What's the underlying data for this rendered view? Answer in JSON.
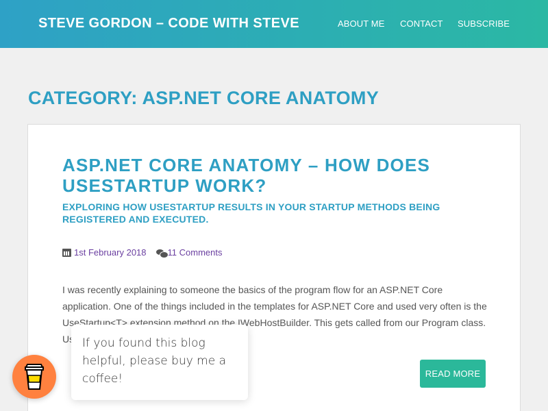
{
  "header": {
    "site_title": "STEVE GORDON – CODE WITH STEVE",
    "nav": [
      "ABOUT ME",
      "CONTACT",
      "SUBSCRIBE"
    ]
  },
  "category_title": "CATEGORY: ASP.NET CORE ANATOMY",
  "post": {
    "title": "ASP.NET CORE ANATOMY – HOW DOES USESTARTUP WORK?",
    "subtitle": "EXPLORING HOW USESTARTUP RESULTS IN YOUR STARTUP METHODS BEING REGISTERED AND EXECUTED.",
    "date": "1st February 2018",
    "comments": "11 Comments",
    "excerpt": "I was recently explaining to someone the basics of the program flow for an ASP.NET Core application. One of the things included in the templates for ASP.NET Core and used very often is the UseStartup<T> extension method on the IWebHostBuilder. This gets called from our Program class. UseStartup allows us to set […]",
    "read_more": "READ MORE"
  },
  "coffee": {
    "message": "If you found this blog helpful, please buy me a coffee!"
  },
  "colors": {
    "accent": "#2e9fc3",
    "header_start": "#2ea1c6",
    "header_end": "#2bb8a4",
    "button": "#2bb89a",
    "coffee": "#ff813f"
  }
}
